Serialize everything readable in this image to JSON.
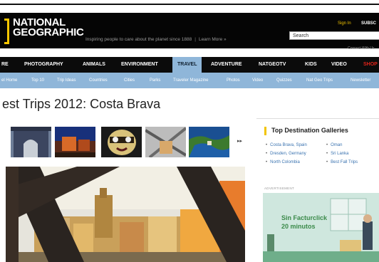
{
  "header": {
    "logo_line1": "NATIONAL",
    "logo_line2": "GEOGRAPHIC",
    "tagline": "Inspiring people to care about the planet since 1888",
    "learn_more": "Learn More »",
    "sign_in": "Sign In",
    "subscribe": "SUBSC",
    "search_placeholder": "Search",
    "connect": "Connect With Us"
  },
  "nav": {
    "items": [
      {
        "label": "RE"
      },
      {
        "label": "PHOTOGRAPHY"
      },
      {
        "label": "ANIMALS"
      },
      {
        "label": "ENVIRONMENT"
      },
      {
        "label": "TRAVEL"
      },
      {
        "label": "ADVENTURE"
      },
      {
        "label": "NATGEOTV"
      },
      {
        "label": "KIDS"
      },
      {
        "label": "VIDEO"
      },
      {
        "label": "SHOP"
      }
    ],
    "active": "TRAVEL"
  },
  "subnav": {
    "items": [
      {
        "label": "el Home"
      },
      {
        "label": "Top 10"
      },
      {
        "label": "Trip Ideas"
      },
      {
        "label": "Countries"
      },
      {
        "label": "Cities"
      },
      {
        "label": "Parks"
      },
      {
        "label": "Traveler Magazine"
      },
      {
        "label": "Photos"
      },
      {
        "label": "Video"
      },
      {
        "label": "Quizzes"
      },
      {
        "label": "Nat Geo Trips"
      },
      {
        "label": "Newsletter"
      }
    ]
  },
  "page": {
    "title": "est Trips 2012: Costa Brava"
  },
  "gallery": {
    "next_label": "▸▸",
    "thumbnails": [
      {
        "subject": "archway"
      },
      {
        "subject": "night-building"
      },
      {
        "subject": "carnival-mask"
      },
      {
        "subject": "bridge-structure"
      },
      {
        "subject": "coastline"
      }
    ]
  },
  "sidebar": {
    "title": "Top Destination Galleries",
    "col1": [
      "Costa Brava, Spain",
      "Dresden, Germany",
      "North Colombia"
    ],
    "col2": [
      "Oman",
      "Sri Lanka",
      "Best Fall Trips"
    ],
    "accent": "#f2c400",
    "link_color": "#3a73b0"
  },
  "advert": {
    "label": "ADVERTISEMENT",
    "line1": "Sin Facturclick",
    "line2": "20 minutos"
  },
  "colors": {
    "header_bg": "#050505",
    "nav_active": "#8fb6d9",
    "brand_yellow": "#f7c600"
  }
}
